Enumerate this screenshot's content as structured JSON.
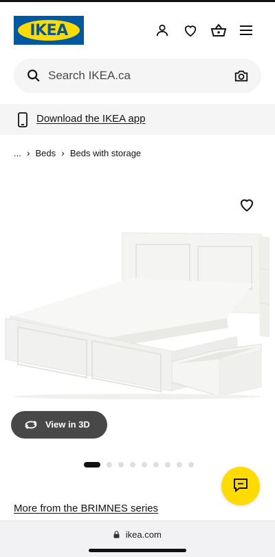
{
  "header": {
    "logo_text": "IKEA",
    "icons": [
      "profile-icon",
      "heart-icon",
      "basket-icon",
      "menu-icon"
    ]
  },
  "search": {
    "placeholder": "Search IKEA.ca"
  },
  "app_banner": {
    "label": "Download the IKEA app"
  },
  "breadcrumb": {
    "items": [
      "...",
      "Beds",
      "Beds with storage"
    ]
  },
  "product": {
    "view3d_label": "View in 3D",
    "gallery_total": 9,
    "gallery_active_index": 0
  },
  "more_series_link": "More from the BRIMNES series",
  "browser": {
    "url": "ikea.com"
  },
  "colors": {
    "brand_blue": "#0058a3",
    "brand_yellow": "#ffdb00",
    "button_dark": "#484848",
    "surface_gray": "#f5f5f5"
  }
}
